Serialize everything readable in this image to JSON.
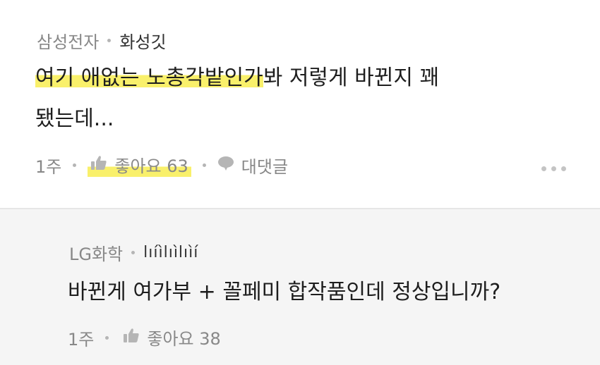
{
  "comment": {
    "affiliation": "삼성전자",
    "nickname": "화성깃",
    "text_highlight": "여기 애없는 노총각밭인가",
    "text_line1_rest": "봐 저렇게 바뀐지 꽤",
    "text_line2": "됐는데...",
    "time": "1주",
    "like_label": "좋아요 63",
    "reply_label": "대댓글"
  },
  "reply": {
    "affiliation": "LG화학",
    "nickname": "lıíìlıìlıìí",
    "text": "바뀐게 여가부 + 꼴페미 합작품인데 정상입니까?",
    "time": "1주",
    "like_label": "좋아요 38"
  },
  "colors": {
    "highlight": "#f9f06b",
    "reply_bg": "#f5f5f5",
    "meta_text": "#888888",
    "body_text": "#1e1e1e"
  },
  "icons": {
    "like": "thumbs-up-icon",
    "reply": "speech-bubble-icon",
    "more": "more-dots-icon"
  }
}
